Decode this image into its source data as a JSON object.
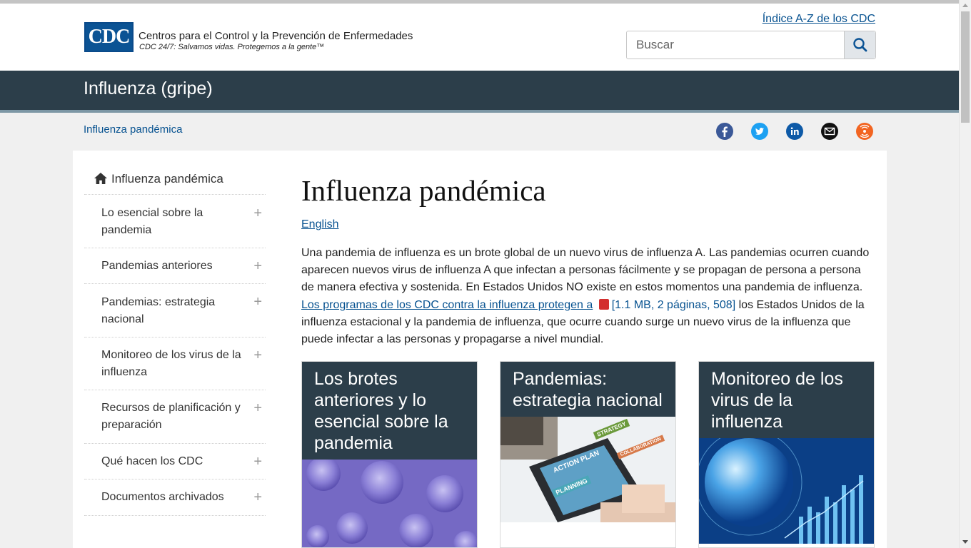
{
  "header": {
    "logo_text": "CDC",
    "org_name": "Centros para el Control y la Prevención de Enfermedades",
    "tagline": "CDC 24/7: Salvamos vidas. Protegemos a la gente™",
    "az_link": "Índice A-Z de los CDC",
    "search_placeholder": "Buscar"
  },
  "banner": {
    "title": "Influenza (gripe)"
  },
  "breadcrumb": "Influenza pandémica",
  "social": [
    {
      "name": "facebook-icon",
      "color": "#3b5998"
    },
    {
      "name": "twitter-icon",
      "color": "#1da1f2"
    },
    {
      "name": "linkedin-icon",
      "color": "#0e5aa7"
    },
    {
      "name": "email-icon",
      "color": "#111111"
    },
    {
      "name": "syndicate-icon",
      "color": "#f26522"
    }
  ],
  "sidenav": {
    "home": "Influenza pandémica",
    "items": [
      {
        "label": "Lo esencial sobre la pandemia"
      },
      {
        "label": "Pandemias anteriores"
      },
      {
        "label": "Pandemias: estrategia nacional"
      },
      {
        "label": "Monitoreo de los virus de la influenza"
      },
      {
        "label": "Recursos de planificación y preparación"
      },
      {
        "label": "Qué hacen los CDC"
      },
      {
        "label": "Documentos archivados"
      }
    ]
  },
  "main": {
    "title": "Influenza pandémica",
    "english_link": "English",
    "intro_text": "Una pandemia de influenza es un brote global de un nuevo virus de influenza A. Las pandemias ocurren cuando aparecen nuevos virus de influenza A que infectan a personas fácilmente y se propagan de persona a persona de manera efectiva y sostenida. En Estados Unidos NO existe en estos momentos una pandemia de influenza.",
    "intro_link": "Los programas de los CDC contra la influenza protegen a",
    "intro_meta": "[1.1 MB, 2 páginas, 508]",
    "intro_rest": "los Estados Unidos de la influenza estacional y la pandemia de influenza, que ocurre cuando surge un nuevo virus de la influenza que puede infectar a las personas y propagarse a nivel mundial.",
    "cards": [
      {
        "title": "Los brotes anteriores y lo esencial sobre la pandemia"
      },
      {
        "title": "Pandemias: estrategia nacional",
        "image_words": [
          "ACTION PLAN",
          "STRATEGY",
          "COLLABORATION",
          "PLANNING"
        ]
      },
      {
        "title": "Monitoreo de los virus de la influenza"
      }
    ]
  }
}
